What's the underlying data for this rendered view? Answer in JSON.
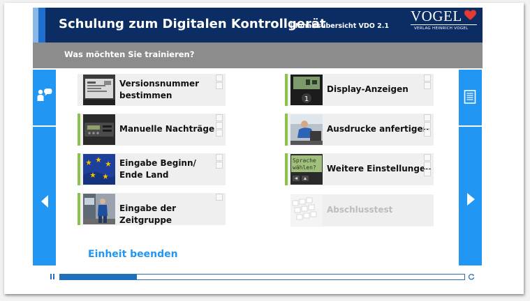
{
  "header": {
    "title": "Schulung zum Digitalen Kontrollgerät",
    "subtitle": "| Inhaltsübersicht VDO 2.1",
    "logo": {
      "word": "VOGEL",
      "tagline": "VERLAG HEINRICH VOGEL",
      "heart_color": "#e53935"
    }
  },
  "question": "Was möchten Sie trainieren?",
  "left_column": [
    {
      "label": "Versionsnummer\nbestimmen",
      "thumb": "device-label-photo",
      "accent": false,
      "boxes": 2
    },
    {
      "label": "Manuelle Nachträge",
      "thumb": "tachograph-photo",
      "accent": true,
      "boxes": 4
    },
    {
      "label": "Eingabe Beginn/\nEnde Land",
      "thumb": "eu-flag-photo",
      "accent": true,
      "boxes": 3
    },
    {
      "label": "Eingabe der Zeitgruppe",
      "thumb": "driver-truck-photo",
      "accent": true,
      "boxes": 1
    }
  ],
  "right_column": [
    {
      "label": "Display-Anzeigen",
      "thumb": "display-photo",
      "accent": true,
      "boxes": 2
    },
    {
      "label": "Ausdrucke anfertigen",
      "thumb": "driver-cab-photo",
      "accent": true,
      "boxes": 4
    },
    {
      "label": "Weitere Einstellungen",
      "thumb": "lcd-language-photo",
      "accent": false,
      "boxes": 3,
      "lcd_text": "Sprache\nwählen?"
    },
    {
      "label": "Abschlusstest",
      "thumb": "keyboard-photo",
      "accent": false,
      "disabled": true,
      "boxes": 0
    }
  ],
  "end_link": "Einheit beenden",
  "player": {
    "progress_percent": 19
  },
  "colors": {
    "primary": "#2196f3",
    "header": "#0b2d63",
    "accent_green": "#8bc34a",
    "question_bar": "#8c8c8c"
  },
  "icons": {
    "left_top": "speaker-person-icon",
    "left_nav": "arrow-left-icon",
    "right_top": "document-list-icon",
    "right_nav": "arrow-right-icon"
  }
}
